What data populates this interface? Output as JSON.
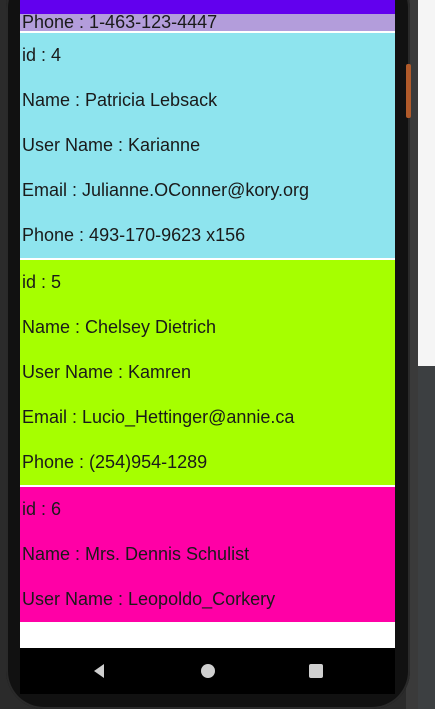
{
  "cards": [
    {
      "color": "#b39ddb",
      "partial": true,
      "rows": [
        "Phone : 1-463-123-4447"
      ]
    },
    {
      "color": "#8ee4ee",
      "rows": [
        "id : 4",
        "Name : Patricia Lebsack",
        "User Name : Karianne",
        "Email : Julianne.OConner@kory.org",
        "Phone : 493-170-9623 x156"
      ]
    },
    {
      "color": "#a6ff00",
      "rows": [
        "id : 5",
        "Name : Chelsey Dietrich",
        "User Name : Kamren",
        "Email : Lucio_Hettinger@annie.ca",
        "Phone : (254)954-1289"
      ]
    },
    {
      "color": "#ff00a6",
      "rows": [
        "id : 6",
        "Name : Mrs. Dennis Schulist",
        "User Name : Leopoldo_Corkery"
      ]
    }
  ],
  "navbar": {
    "back_icon": "back-triangle-icon",
    "home_icon": "home-circle-icon",
    "recent_icon": "recents-square-icon"
  }
}
